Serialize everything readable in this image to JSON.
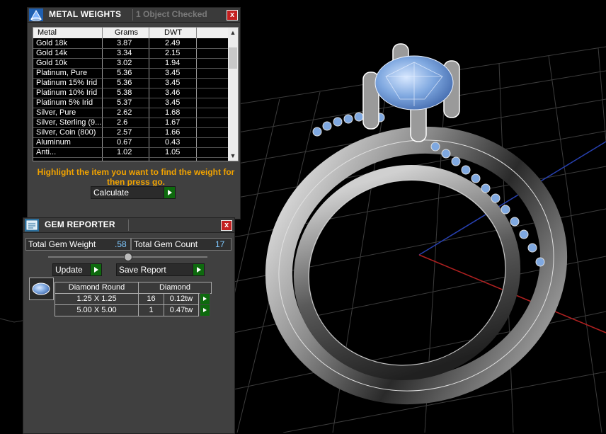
{
  "metal_weights": {
    "title": "METAL WEIGHTS",
    "status": "1 Object Checked",
    "close_label": "x",
    "columns": [
      "Metal",
      "Grams",
      "DWT"
    ],
    "rows": [
      {
        "metal": "Gold 18k",
        "grams": "3.87",
        "dwt": "2.49"
      },
      {
        "metal": "Gold 14k",
        "grams": "3.34",
        "dwt": "2.15"
      },
      {
        "metal": "Gold 10k",
        "grams": "3.02",
        "dwt": "1.94"
      },
      {
        "metal": "Platinum, Pure",
        "grams": "5.36",
        "dwt": "3.45"
      },
      {
        "metal": "Platinum 15% Irid",
        "grams": "5.36",
        "dwt": "3.45"
      },
      {
        "metal": "Platinum 10% Irid",
        "grams": "5.38",
        "dwt": "3.46"
      },
      {
        "metal": "Platinum 5% Irid",
        "grams": "5.37",
        "dwt": "3.45"
      },
      {
        "metal": "Silver, Pure",
        "grams": "2.62",
        "dwt": "1.68"
      },
      {
        "metal": "Silver, Sterling (9...",
        "grams": "2.6",
        "dwt": "1.67"
      },
      {
        "metal": "Silver, Coin (800)",
        "grams": "2.57",
        "dwt": "1.66"
      },
      {
        "metal": "Aluminum",
        "grams": "0.67",
        "dwt": "0.43"
      },
      {
        "metal": "Anti...",
        "grams": "1.02",
        "dwt": "1.05"
      }
    ],
    "instruction": "Highlight the item you want to find the weight for then press go.",
    "calculate_label": "Calculate"
  },
  "gem_reporter": {
    "title": "GEM REPORTER",
    "close_label": "x",
    "total_gem_weight_label": "Total Gem Weight",
    "total_gem_weight": ".58",
    "total_gem_count_label": "Total Gem Count",
    "total_gem_count": "17",
    "update_label": "Update",
    "save_report_label": "Save Report",
    "table": {
      "shape": "Diamond Round",
      "stone": "Diamond",
      "rows": [
        {
          "size": "1.25 X 1.25",
          "count": "16",
          "weight": "0.12tw"
        },
        {
          "size": "5.00 X 5.00",
          "count": "1",
          "weight": "0.47tw"
        }
      ]
    }
  },
  "colors": {
    "panel_bg": "#404040",
    "accent_orange": "#f2a300",
    "value_blue": "#7ec8ff",
    "go_green": "#0e6a0e",
    "close_red": "#c42020",
    "gem_blue": "#7fa8e0"
  },
  "icons": [
    "metal-weights-icon",
    "gem-reporter-icon",
    "close-icon",
    "go-arrow-icon",
    "scroll-up-icon",
    "scroll-down-icon",
    "gem-thumbnail-icon"
  ]
}
